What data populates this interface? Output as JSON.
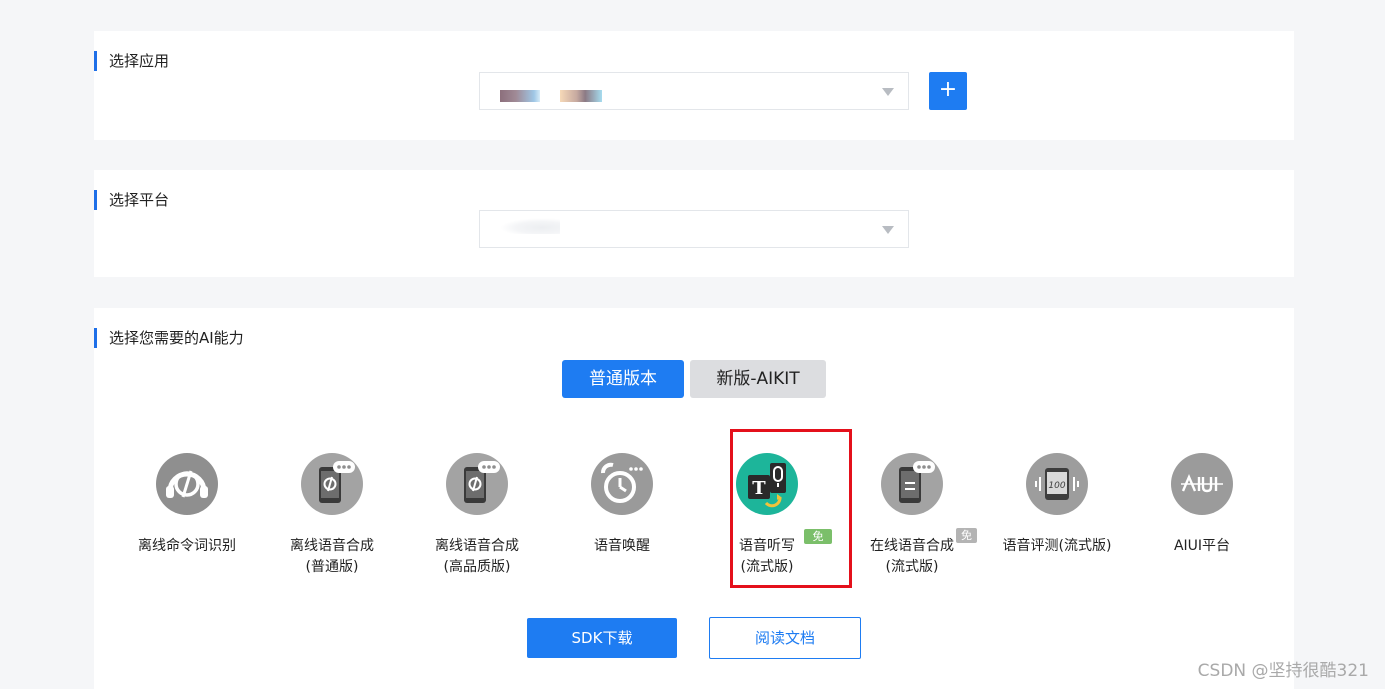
{
  "sections": {
    "app": {
      "title": "选择应用",
      "add_label": "+"
    },
    "platform": {
      "title": "选择平台"
    },
    "ai": {
      "title": "选择您需要的AI能力"
    }
  },
  "tabs": [
    {
      "label": "普通版本",
      "active": true
    },
    {
      "label": "新版-AIKIT",
      "active": false
    }
  ],
  "abilities": [
    {
      "line1": "离线命令词识别",
      "line2": "",
      "icon": "headset-c-icon"
    },
    {
      "line1": "离线语音合成",
      "line2": "(普通版)",
      "icon": "phone-chat-icon"
    },
    {
      "line1": "离线语音合成",
      "line2": "(高品质版)",
      "icon": "phone-chat-icon"
    },
    {
      "line1": "语音唤醒",
      "line2": "",
      "icon": "alarm-clock-icon"
    },
    {
      "line1": "语音听写",
      "line2": "(流式版)",
      "icon": "text-microphone-icon",
      "badge": "免费"
    },
    {
      "line1": "在线语音合成",
      "line2": "(流式版)",
      "icon": "phone-document-icon",
      "badge": "免费"
    },
    {
      "line1": "语音评测(流式版)",
      "line2": "",
      "icon": "score-waveform-icon"
    },
    {
      "line1": "AIUI平台",
      "line2": "",
      "icon": "aiui-logo-icon"
    }
  ],
  "buttons": {
    "sdk_download": "SDK下载",
    "read_docs": "阅读文档"
  },
  "watermark": "CSDN @坚持很酷321",
  "colors": {
    "accent": "#1e7cf2",
    "highlight": "#e4101b",
    "badge_green": "#7bbf6a",
    "icon_gray": "#9b9b9b",
    "icon_teal": "#1db59a"
  }
}
